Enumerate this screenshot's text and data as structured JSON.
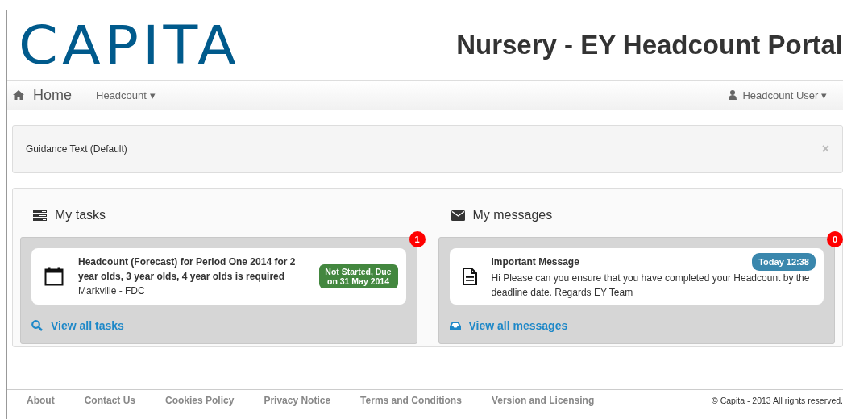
{
  "header": {
    "logo": "CAPITA",
    "title": "Nursery - EY Headcount Portal"
  },
  "navbar": {
    "home": "Home",
    "menus": [
      {
        "label": "Headcount",
        "caret": "▾"
      }
    ],
    "user": {
      "label": "Headcount User",
      "caret": "▾"
    }
  },
  "guidance": {
    "text": "Guidance Text (Default)",
    "close": "×"
  },
  "panels": [
    {
      "kind": "tasks",
      "title": "My tasks",
      "count": "1",
      "item": {
        "title": "Headcount (Forecast) for Period One 2014 for 2 year olds, 3 year olds, 4 year olds is required",
        "subtitle": "Markville - FDC",
        "status": "Not Started, Due on 31 May 2014"
      },
      "link": "View all tasks"
    },
    {
      "kind": "messages",
      "title": "My messages",
      "count": "0",
      "item": {
        "title": "Important Message",
        "body": "Hi Please can you ensure that you have completed your Headcount by the deadline date. Regards EY Team",
        "time": "Today 12:38"
      },
      "link": "View all messages"
    }
  ],
  "footer": {
    "links": [
      "About",
      "Contact Us",
      "Cookies Policy",
      "Privacy Notice",
      "Terms and Conditions",
      "Version and Licensing"
    ],
    "copyright": "© Capita - 2013 All rights reserved."
  }
}
